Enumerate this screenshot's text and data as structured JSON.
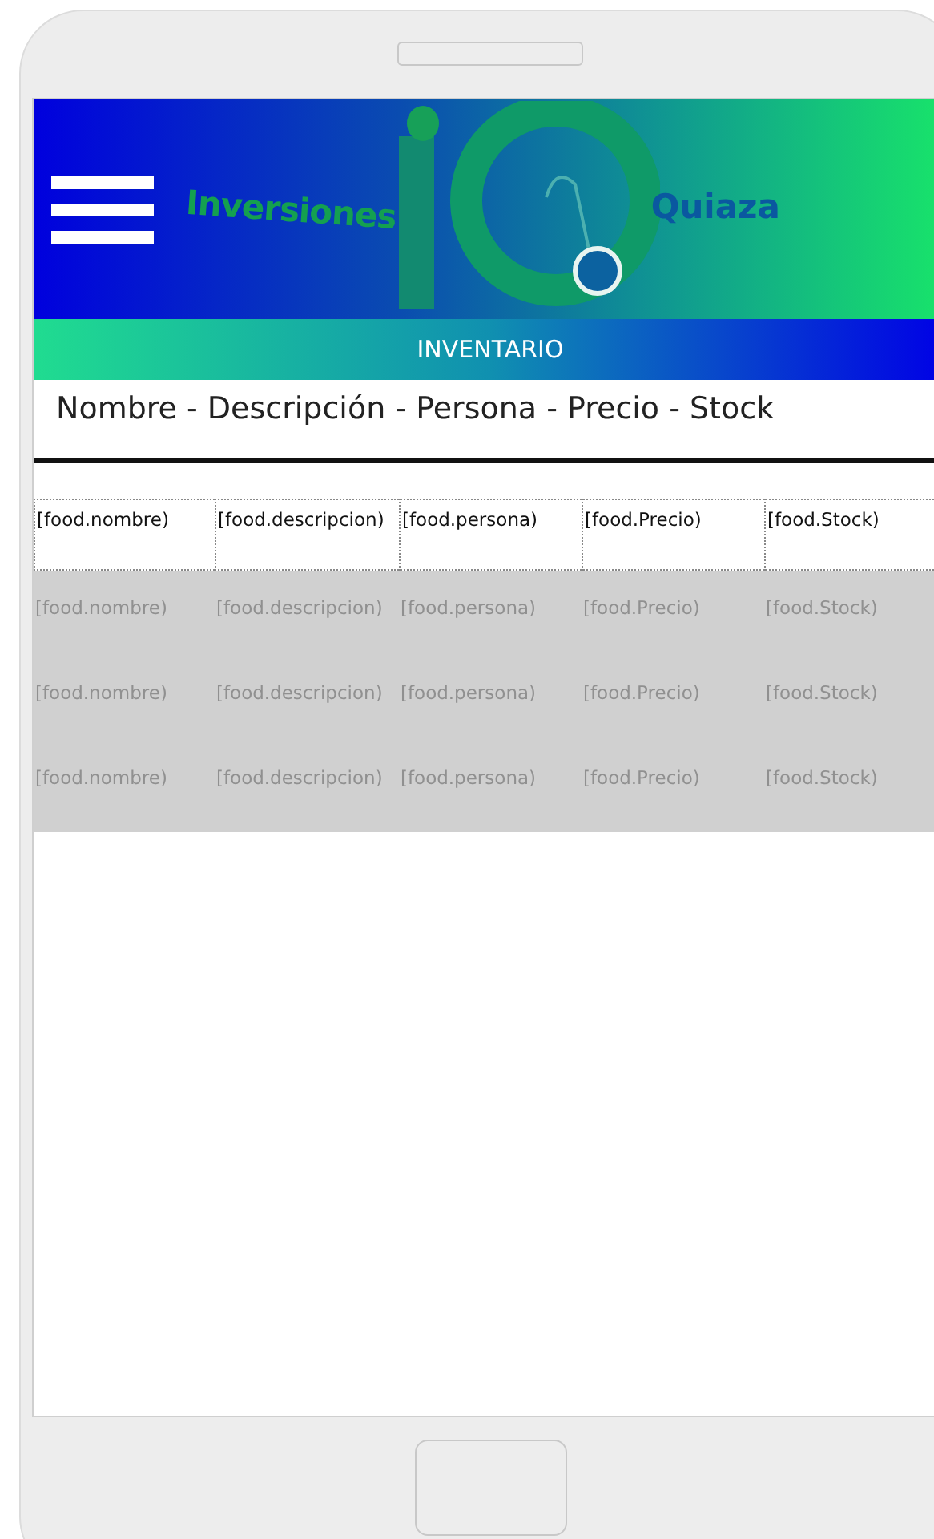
{
  "header": {
    "logo_left": "Inversiones",
    "logo_right": "Quiaza"
  },
  "band": {
    "title": "INVENTARIO"
  },
  "list_heading": "Nombre - Descripción - Persona - Precio - Stock",
  "template_row": [
    "[food.nombre)",
    "[food.descripcion)",
    "[food.persona)",
    "[food.Precio)",
    "[food.Stock)"
  ],
  "rows": [
    [
      "[food.nombre)",
      "[food.descripcion)",
      "[food.persona)",
      "[food.Precio)",
      "[food.Stock)"
    ],
    [
      "[food.nombre)",
      "[food.descripcion)",
      "[food.persona)",
      "[food.Precio)",
      "[food.Stock)"
    ],
    [
      "[food.nombre)",
      "[food.descripcion)",
      "[food.persona)",
      "[food.Precio)",
      "[food.Stock)"
    ]
  ]
}
